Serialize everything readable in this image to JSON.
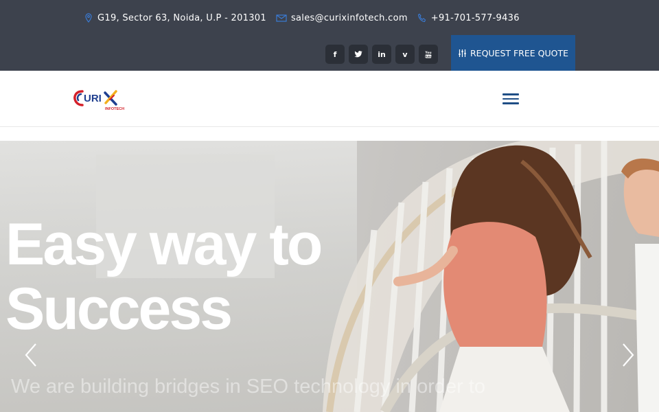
{
  "topbar": {
    "address": "G19, Sector 63, Noida, U.P - 201301",
    "email": "sales@curixinfotech.com",
    "phone": "+91-701-577-9436",
    "socials": [
      {
        "icon": "facebook-icon",
        "glyph": "f"
      },
      {
        "icon": "twitter-icon",
        "glyph": "t"
      },
      {
        "icon": "linkedin-icon",
        "glyph": "in"
      },
      {
        "icon": "vimeo-icon",
        "glyph": "v"
      },
      {
        "icon": "youtube-icon",
        "glyph": "You"
      }
    ],
    "quote_label": "REQUEST FREE QUOTE"
  },
  "navbar": {
    "logo_text": "URI",
    "logo_sub": "INFOTECH"
  },
  "hero": {
    "title_line1": "Easy way to",
    "title_line2": "Success",
    "subtitle_line1": "We are building bridges in SEO technology in order to"
  },
  "colors": {
    "topbar_bg": "#3d424d",
    "accent": "#1f5591",
    "menu": "#1f4e86"
  }
}
